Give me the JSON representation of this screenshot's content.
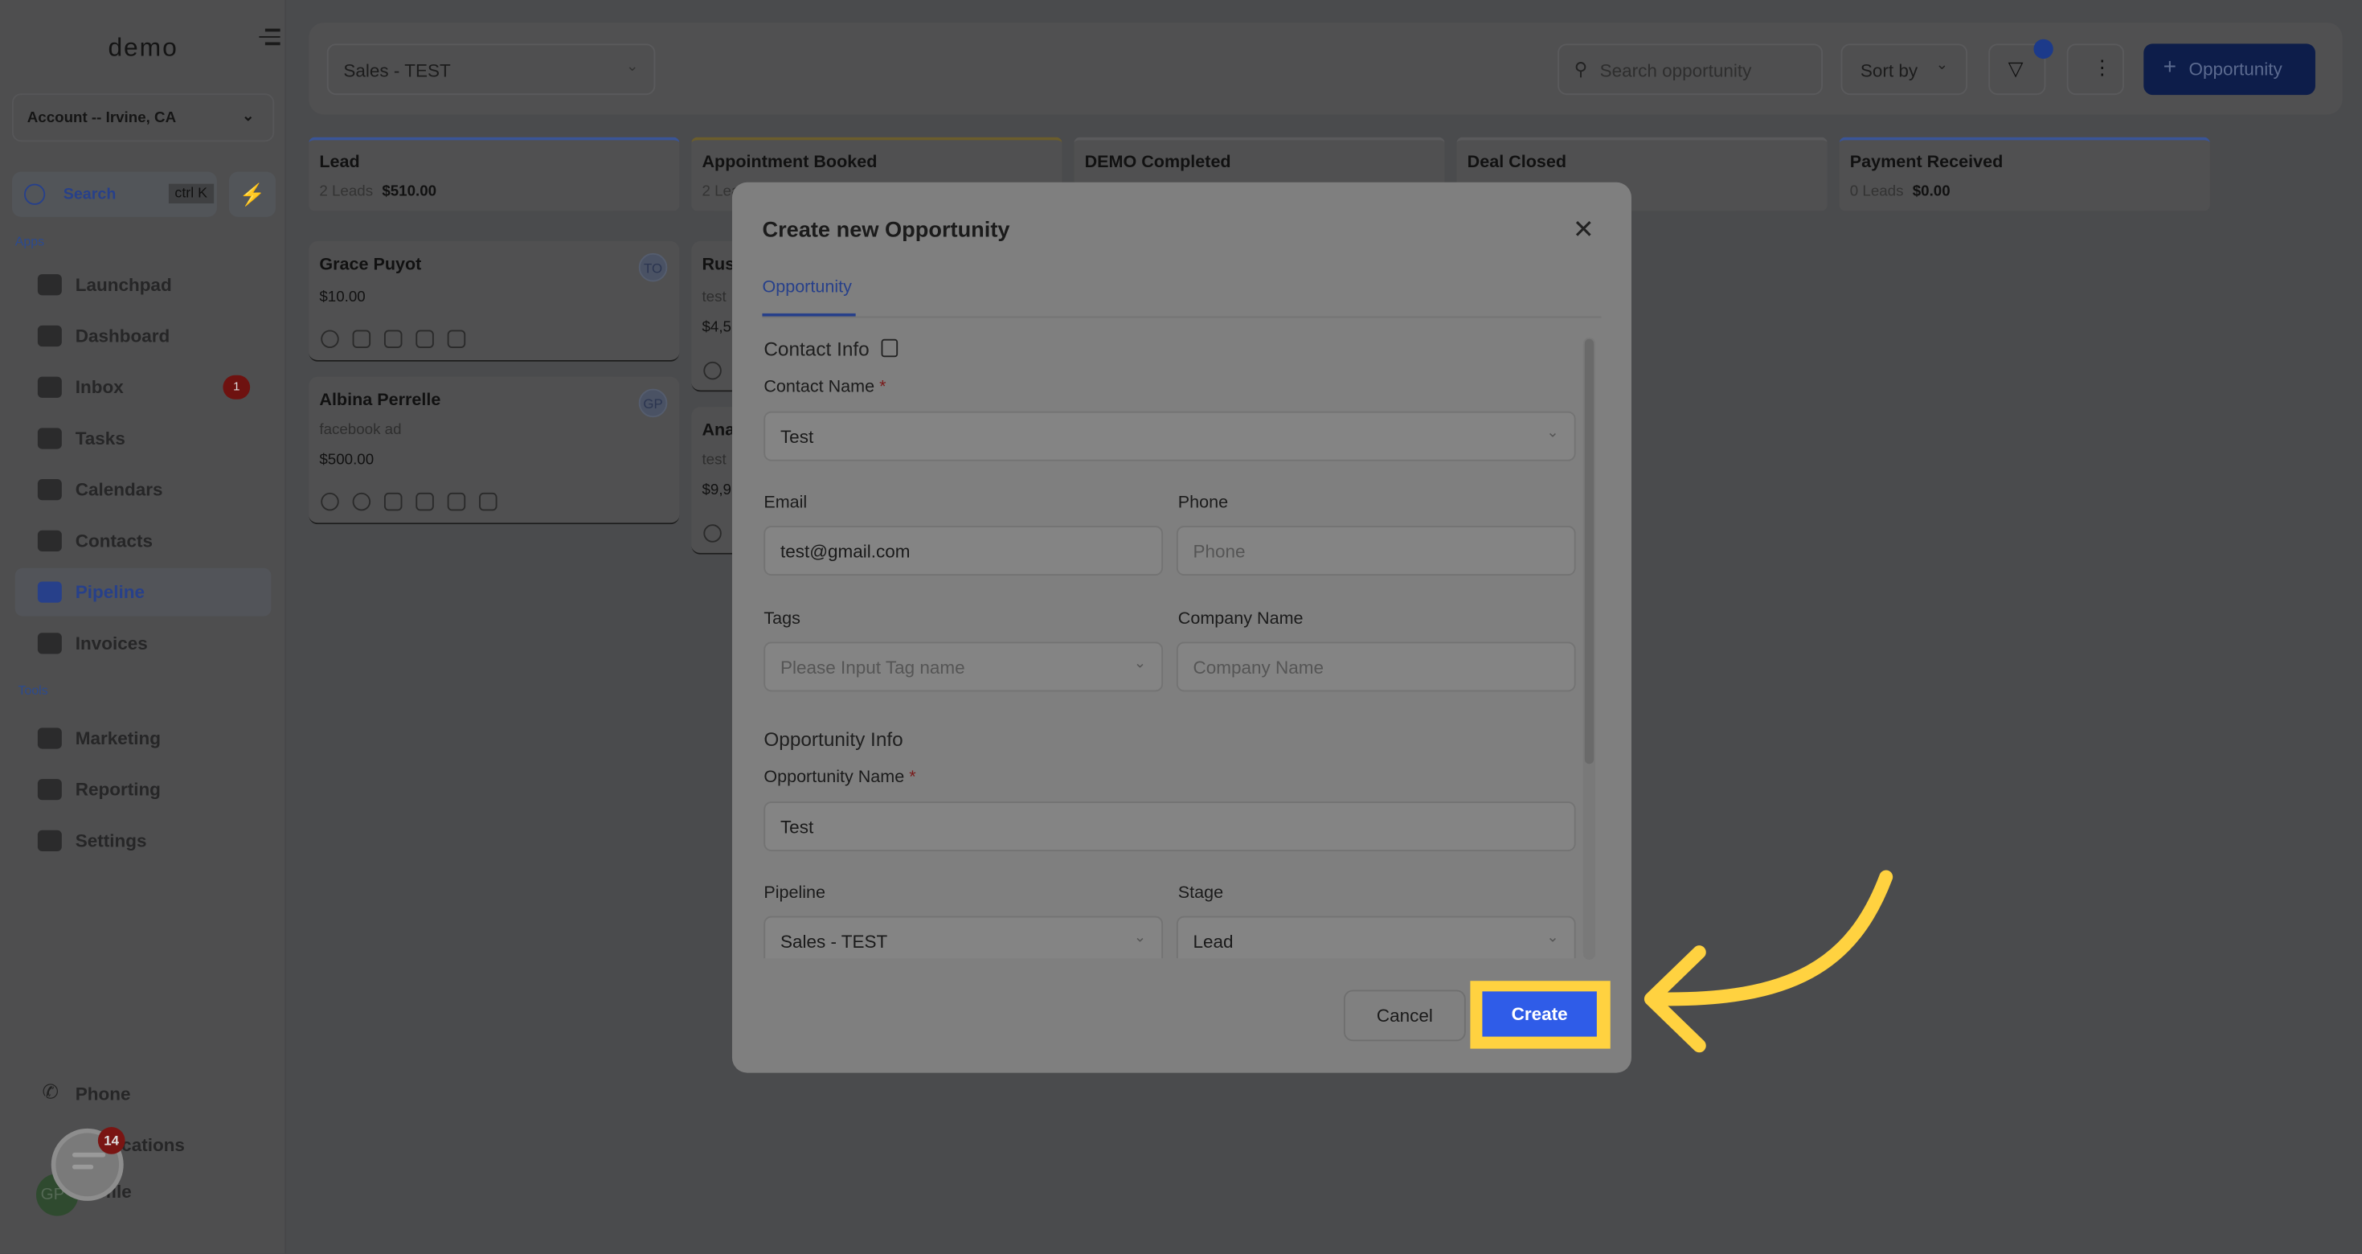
{
  "sidebar": {
    "logo": "demo",
    "account": "Account -- Irvine, CA",
    "search_label": "Search",
    "search_shortcut": "ctrl K",
    "apps_label": "Apps",
    "tools_label": "Tools",
    "apps": [
      {
        "label": "Launchpad",
        "icon": "rocket-icon"
      },
      {
        "label": "Dashboard",
        "icon": "dashboard-icon"
      },
      {
        "label": "Inbox",
        "icon": "inbox-icon",
        "badge": "1"
      },
      {
        "label": "Tasks",
        "icon": "tasks-icon"
      },
      {
        "label": "Calendars",
        "icon": "calendar-icon"
      },
      {
        "label": "Contacts",
        "icon": "contacts-icon"
      },
      {
        "label": "Pipeline",
        "icon": "filter-icon",
        "active": true
      },
      {
        "label": "Invoices",
        "icon": "invoice-icon"
      }
    ],
    "tools": [
      {
        "label": "Marketing",
        "icon": "megaphone-icon"
      },
      {
        "label": "Reporting",
        "icon": "pie-chart-icon"
      },
      {
        "label": "Settings",
        "icon": "gear-icon"
      }
    ],
    "bottom": {
      "phone": "Phone",
      "notifications": "Notifications",
      "profile": "Profile",
      "avatar_initials": "GP",
      "chat_badge": "14"
    }
  },
  "topbar": {
    "pipeline_select": "Sales - TEST",
    "search_placeholder": "Search opportunity",
    "sort_label": "Sort by",
    "add_button": "Opportunity"
  },
  "columns": [
    {
      "name": "Lead",
      "count": "2 Leads",
      "total": "$510.00"
    },
    {
      "name": "Appointment Booked",
      "count": "2 Leads",
      "total": ""
    },
    {
      "name": "DEMO Completed",
      "count": "",
      "total": ""
    },
    {
      "name": "Deal Closed",
      "count": "",
      "total": ""
    },
    {
      "name": "Payment Received",
      "count": "0 Leads",
      "total": "$0.00"
    }
  ],
  "cards": [
    {
      "name": "Grace Puyot",
      "source": "",
      "value": "$10.00",
      "avatar": "TO"
    },
    {
      "name": "Albina Perrelle",
      "source": "facebook ad",
      "value": "$500.00",
      "avatar": "GP"
    },
    {
      "name": "Rus",
      "source": "test",
      "value": "$4,5"
    },
    {
      "name": "Ana",
      "source": "test",
      "value": "$9,9"
    }
  ],
  "modal": {
    "title": "Create new Opportunity",
    "tab": "Opportunity",
    "contact_info": "Contact Info",
    "contact_name_label": "Contact Name",
    "contact_name_value": "Test",
    "email_label": "Email",
    "email_value": "test@gmail.com",
    "phone_label": "Phone",
    "phone_placeholder": "Phone",
    "tags_label": "Tags",
    "tags_placeholder": "Please Input Tag name",
    "company_label": "Company Name",
    "company_placeholder": "Company Name",
    "opportunity_info": "Opportunity Info",
    "opp_name_label": "Opportunity Name",
    "opp_name_value": "Test",
    "pipeline_label": "Pipeline",
    "pipeline_value": "Sales - TEST",
    "stage_label": "Stage",
    "stage_value": "Lead",
    "required_mark": "*",
    "cancel": "Cancel",
    "create": "Create"
  },
  "colors": {
    "highlight": "#ffd240",
    "create_button": "#2f5ce8",
    "accent": "#27408a"
  }
}
